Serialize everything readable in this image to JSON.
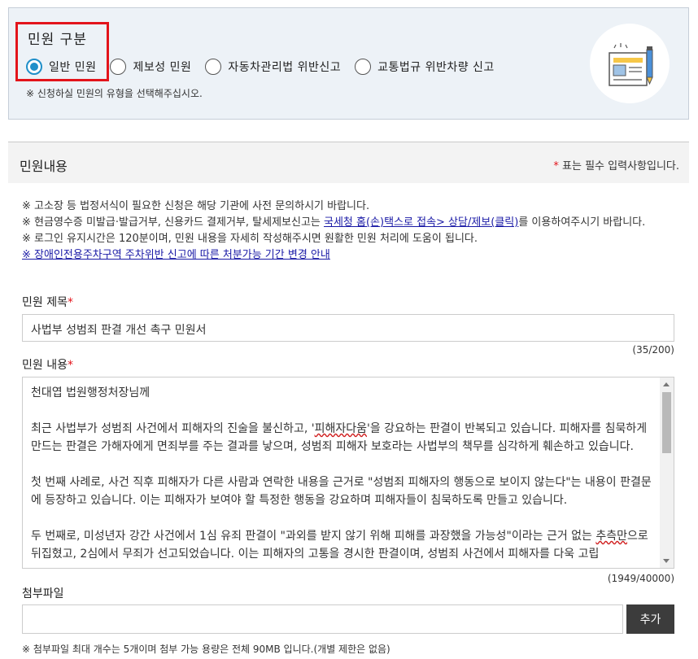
{
  "complaint_type": {
    "title": "민원 구분",
    "options": [
      "일반 민원",
      "제보성 민원",
      "자동차관리법 위반신고",
      "교통법규 위반차량 신고"
    ],
    "selected_index": 0,
    "hint": "※ 신청하실 민원의 유형을 선택해주십시오."
  },
  "content": {
    "title": "민원내용",
    "required_star": "*",
    "required_note": " 표는 필수 입력사항입니다."
  },
  "notices": {
    "line1": "※ 고소장 등 법정서식이 필요한 신청은 해당 기관에 사전 문의하시기 바랍니다.",
    "line2_pre": "※ 현금영수증 미발급·발급거부, 신용카드 결제거부, 탈세제보신고는 ",
    "line2_link": "국세청 홈(손)택스로 접속> 상담/제보(클릭)",
    "line2_post": "를 이용하여주시기 바랍니다.",
    "line3": "※ 로그인 유지시간은 120분이며, 민원 내용을 자세히 작성해주시면 원활한 민원 처리에 도움이 됩니다.",
    "line4_link": "※ 장애인전용주차구역 주차위반 신고에 따른 처분가능 기간 변경 안내"
  },
  "form": {
    "title_label": "민원 제목",
    "title_value": "사법부 성범죄 판결 개선 촉구 민원서",
    "title_counter": "(35/200)",
    "body_label": "민원 내용",
    "body_counter": "(1949/40000)",
    "body": {
      "greeting": "천대엽 법원행정처장님께",
      "para1_a": "최근 사법부가 성범죄 사건에서 피해자의 진술을 불신하고, '",
      "para1_b": "피해자다움",
      "para1_c": "'을 강요하는 판결이 반복되고 있습니다. 피해자를 침묵하게 만드는 판결은 가해자에게 면죄부를 주는 결과를 낳으며, 성범죄 피해자 보호라는 사법부의 책무를 심각하게 훼손하고 있습니다.",
      "para2": "첫 번째 사례로, 사건 직후 피해자가 다른 사람과 연락한 내용을 근거로 \"성범죄 피해자의 행동으로 보이지 않는다\"는 내용이 판결문에 등장하고 있습니다. 이는 피해자가 보여야 할 특정한 행동을 강요하며 피해자들이 침묵하도록 만들고 있습니다.",
      "para3_a": "두 번째로, 미성년자 강간 사건에서 1심 유죄 판결이 \"과외를 받지 않기 위해 피해를 과장했을 가능성\"이라는 근거 없는 ",
      "para3_b": "추측만",
      "para3_c": "으로 뒤집혔고, 2심에서 무죄가 선고되었습니다. 이는 피해자의 고통을 경시한 판결이며, 성범죄 사건에서 피해자를 다욱 고립"
    },
    "attach_label": "첨부파일",
    "attach_button": "추가",
    "attach_hint": "※ 첨부파일 최대 개수는 5개이며 첨부 가능 용량은 전체 90MB 입니다.(개별 제한은 없음)"
  }
}
